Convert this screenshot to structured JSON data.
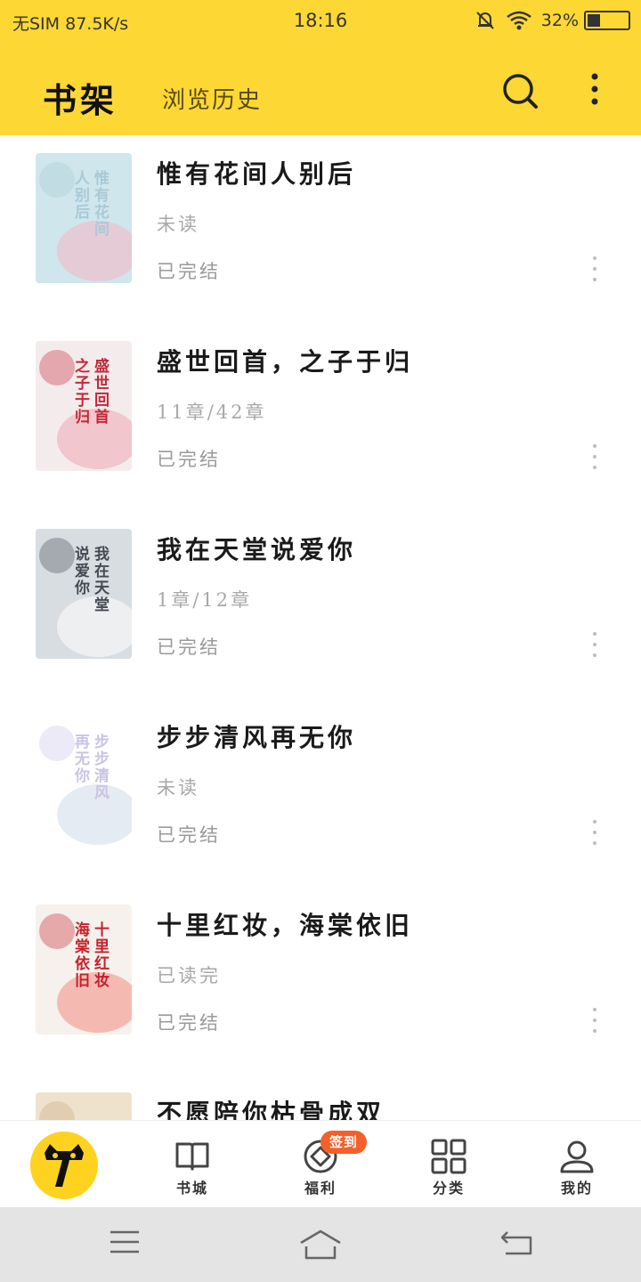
{
  "status_bar": {
    "carrier": "无SIM",
    "speed": "87.5K/s",
    "time": "18:16",
    "battery": "32%",
    "battery_level": 0.32,
    "icons": [
      "bell-off-icon",
      "wifi-icon",
      "battery-icon"
    ]
  },
  "app_bar": {
    "tab_active": "书架",
    "tab_inactive": "浏览历史",
    "icons": [
      "search-icon",
      "more-vertical-icon"
    ]
  },
  "books": [
    {
      "title": "惟有花间人别后",
      "progress": "未读",
      "status": "已完结"
    },
    {
      "title": "盛世回首，之子于归",
      "progress": "11章/42章",
      "status": "已完结"
    },
    {
      "title": "我在天堂说爱你",
      "progress": "1章/12章",
      "status": "已完结"
    },
    {
      "title": "步步清风再无你",
      "progress": "未读",
      "status": "已完结"
    },
    {
      "title": "十里红妆，海棠依旧",
      "progress": "已读完",
      "status": "已完结"
    },
    {
      "title": "不愿陪你枯骨成双",
      "progress": "",
      "status": ""
    }
  ],
  "covers": [
    {
      "text": "惟有花间人别后",
      "colors": [
        "#cfe6ec",
        "#a9c9d6",
        "#e8c6d2"
      ]
    },
    {
      "text": "盛世回首之子于归",
      "colors": [
        "#f4ecec",
        "#c2283a",
        "#f0c0c8"
      ]
    },
    {
      "text": "我在天堂说爱你",
      "colors": [
        "#d8dde2",
        "#444a52",
        "#f2f2f2"
      ]
    },
    {
      "text": "步步清风再无你",
      "colors": [
        "#ffffff",
        "#c9c3e6",
        "#dfe8f0"
      ]
    },
    {
      "text": "十里红妆海棠依旧",
      "colors": [
        "#f6f1ec",
        "#c3222c",
        "#f3b0a8"
      ]
    },
    {
      "text": "",
      "colors": [
        "#efe2cc",
        "#c9a97c",
        "#f6ecde"
      ]
    }
  ],
  "bottom_nav": {
    "items": [
      "书城",
      "福利",
      "分类",
      "我的"
    ],
    "badge": "签到",
    "icons": [
      "cat-logo-icon",
      "book-open-icon",
      "gift-icon",
      "grid-icon",
      "user-icon"
    ]
  },
  "system_nav": {
    "icons": [
      "menu-icon",
      "home-icon",
      "back-icon"
    ]
  },
  "colors": {
    "accent": "#fdd835",
    "badge": "#f5602a",
    "text_secondary": "#a8a8a8"
  }
}
